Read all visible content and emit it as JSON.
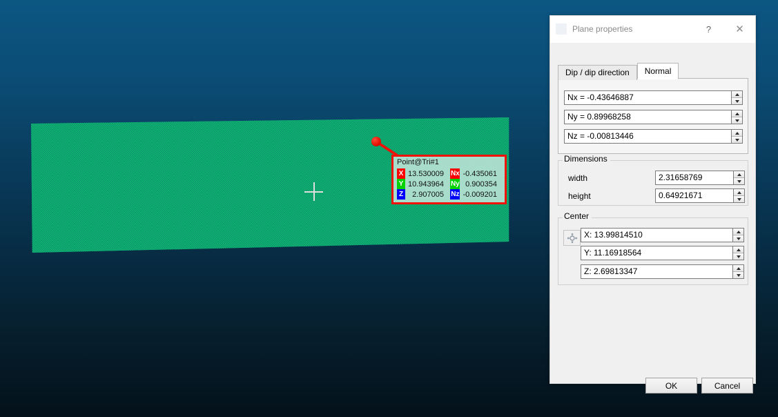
{
  "viewport": {
    "label": {
      "title": "Point@Tri#1",
      "rows": [
        {
          "axis": "X",
          "value": "13.530009",
          "naxis": "Nx",
          "nvalue": "-0.435061"
        },
        {
          "axis": "Y",
          "value": "10.943964",
          "naxis": "Ny",
          "nvalue": "0.900354"
        },
        {
          "axis": "Z",
          "value": "2.907005",
          "naxis": "Nz",
          "nvalue": "-0.009201"
        }
      ]
    },
    "colors": {
      "mesh": "#0ebc6b",
      "mesh_dither": "#0d8f72",
      "marker": "#ee1206",
      "label_border": "#f21105",
      "background_top": "#0c5683",
      "background_bottom": "#04111a",
      "badge_x": "#fb0000",
      "badge_y": "#00d200",
      "badge_z": "#0000ff"
    }
  },
  "dialog": {
    "title": "Plane properties",
    "app_icon": "cloudcompare-icon",
    "help_label": "?",
    "close_label": "✕",
    "tabs": [
      {
        "label": "Dip / dip direction",
        "active": false
      },
      {
        "label": "Normal",
        "active": true
      }
    ],
    "normal": {
      "nx": "Nx = -0.43646887",
      "ny": "Ny = 0.89968258",
      "nz": "Nz = -0.00813446"
    },
    "dimensions": {
      "title": "Dimensions",
      "width_label": "width",
      "width_value": "2.31658769",
      "height_label": "height",
      "height_value": "0.64921671"
    },
    "center": {
      "title": "Center",
      "x_value": "X: 13.99814510",
      "y_value": "Y: 11.16918564",
      "z_value": "Z: 2.69813347",
      "pick_button": "axis-pick-icon"
    },
    "buttons": {
      "ok": "OK",
      "cancel": "Cancel"
    }
  }
}
